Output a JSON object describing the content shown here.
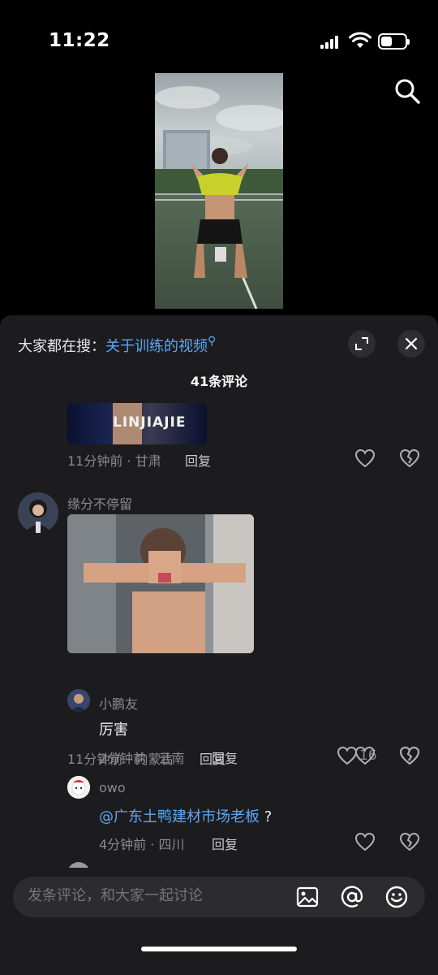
{
  "status": {
    "time": "11:22",
    "battery_level": 0.45
  },
  "icons": {
    "search": "search-icon",
    "expand": "expand-icon",
    "close": "close-icon",
    "like": "heart-icon",
    "dislike": "broken-heart-icon",
    "image": "image-icon",
    "mention": "at-icon",
    "emoji": "emoji-icon"
  },
  "sheet": {
    "hint_prefix": "大家都在搜：",
    "hint_link": "关于训练的视频",
    "comment_count": "41条评论"
  },
  "comments": {
    "c0": {
      "image_text": "LINJIAJIE",
      "meta": "11分钟前 · 甘肃",
      "reply": "回复"
    },
    "c1": {
      "author": "缘分不停留",
      "meta": "11分钟前 · 内蒙古",
      "reply": "回复",
      "likes": "16"
    },
    "r1": {
      "author": "小鹏友",
      "text": "厉害",
      "meta": "2分钟前 · 云南",
      "reply": "回复"
    },
    "r2": {
      "author": "owo",
      "mention": "@广东土鸭建材市场老板",
      "text_suffix": " ?",
      "meta": "4分钟前 · 四川",
      "reply": "回复"
    }
  },
  "input": {
    "placeholder": "发条评论，和大家一起讨论"
  },
  "colors": {
    "accent": "#5ea7f5",
    "sheet_bg": "#1c1c1e",
    "muted": "#8a8a8e"
  }
}
